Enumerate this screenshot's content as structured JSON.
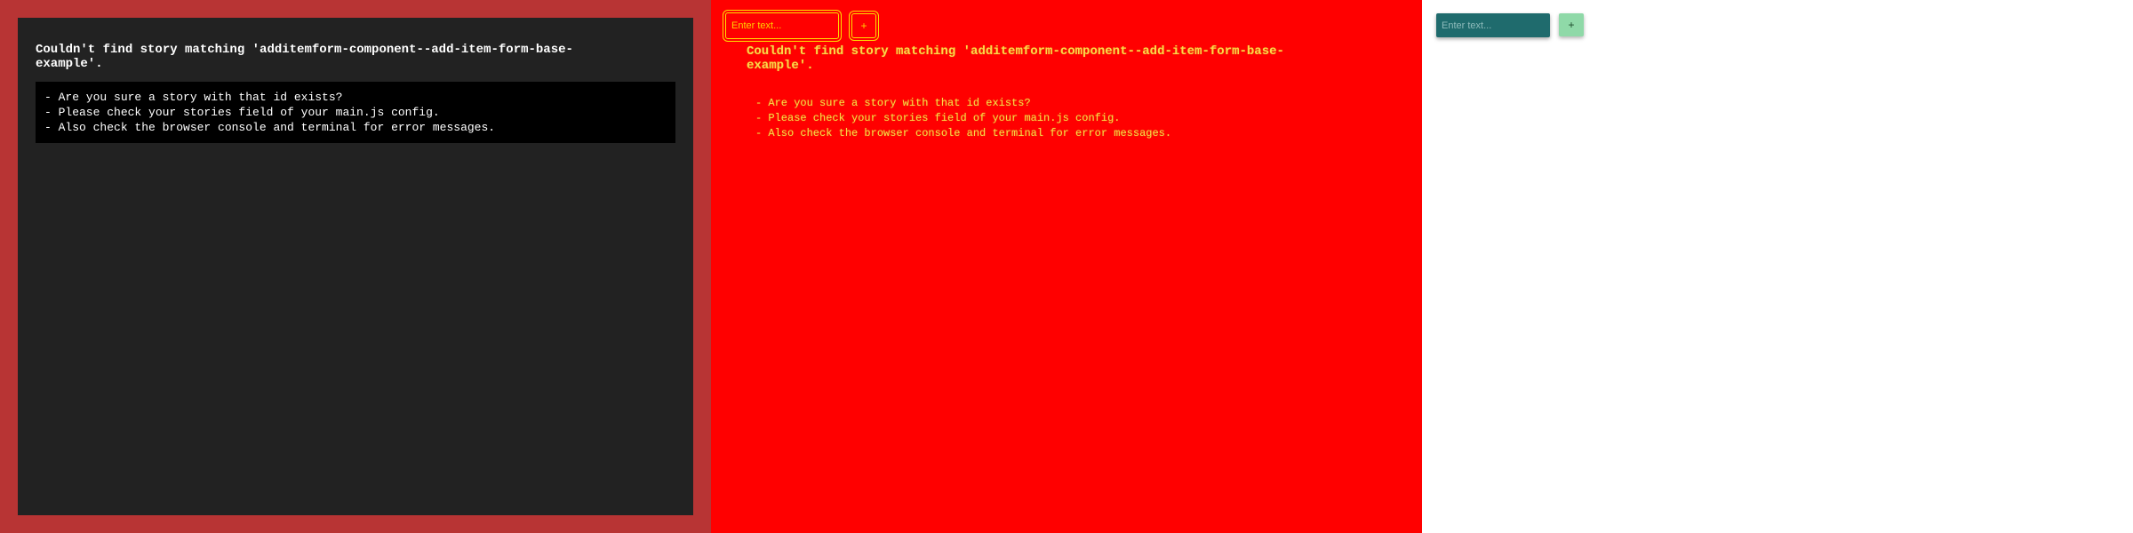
{
  "error_view": {
    "title": "Couldn't find story matching 'additemform-component--add-item-form-base-example'.",
    "lines": [
      "- Are you sure a story with that id exists?",
      "- Please check your stories field of your main.js config.",
      "- Also check the browser console and terminal for error messages."
    ]
  },
  "debug_view": {
    "input_placeholder": "Enter text...",
    "add_button_label": "+",
    "title": "Couldn't find story matching 'additemform-component--add-item-form-base-example'.",
    "lines": [
      "- Are you sure a story with that id exists?",
      "- Please check your stories field of your main.js config.",
      "- Also check the browser console and terminal for error messages."
    ]
  },
  "component_view": {
    "input_placeholder": "Enter text...",
    "add_button_label": "+"
  },
  "colors": {
    "error_frame": "#b83434",
    "error_card": "#222222",
    "debug_background": "#ff0000",
    "debug_outline": "#ffdd00",
    "input_background": "#1f6b6d",
    "add_button_background": "#8fd9a8"
  }
}
